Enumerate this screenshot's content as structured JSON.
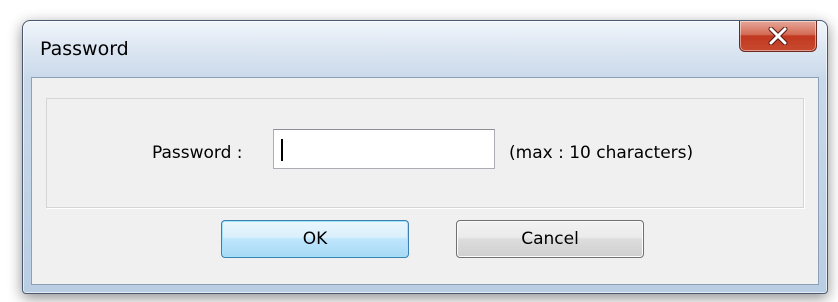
{
  "window": {
    "title": "Password",
    "close_icon": "close-x-icon"
  },
  "form": {
    "password_label": "Password :",
    "password_value": "",
    "max_note": "(max : 10 characters)"
  },
  "buttons": {
    "ok_label": "OK",
    "cancel_label": "Cancel"
  },
  "colors": {
    "close_button": "#c84a30",
    "ok_button_border": "#3c7fb1",
    "dialog_background": "#f0f0f0"
  }
}
